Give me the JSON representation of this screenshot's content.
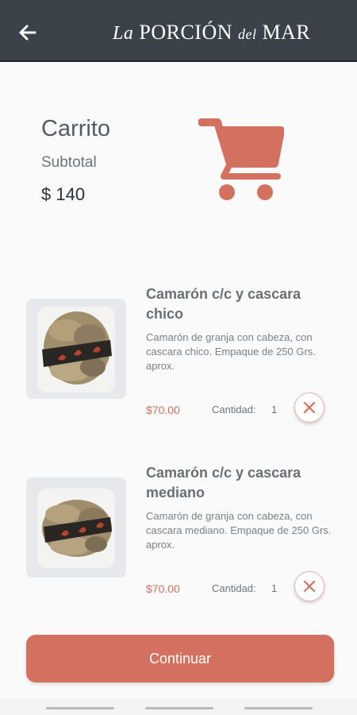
{
  "header": {
    "back_icon": "arrow-left-icon",
    "brand": {
      "la": "La",
      "porcion": "PORCIÓN",
      "del": "del",
      "mar": "MAR"
    }
  },
  "cart": {
    "title": "Carrito",
    "subtotal_label": "Subtotal",
    "subtotal_value": "$ 140",
    "icon": "shopping-cart-icon",
    "accent_color": "#d4705f"
  },
  "items": [
    {
      "name": "Camarón c/c y cascara chico",
      "description": "Camarón de granja con cabeza, con cascara chico. Empaque de 250 Grs. aprox.",
      "price": "$70.00",
      "quantity_label": "Cantidad:",
      "quantity": "1",
      "remove_icon": "close-icon"
    },
    {
      "name": "Camarón c/c y cascara mediano",
      "description": "Camarón de granja con cabeza, con cascara mediano. Empaque de 250 Grs. aprox.",
      "price": "$70.00",
      "quantity_label": "Cantidad:",
      "quantity": "1",
      "remove_icon": "close-icon"
    }
  ],
  "actions": {
    "continue_label": "Continuar"
  },
  "colors": {
    "header_bg": "#3b424a",
    "accent": "#d4705f"
  }
}
